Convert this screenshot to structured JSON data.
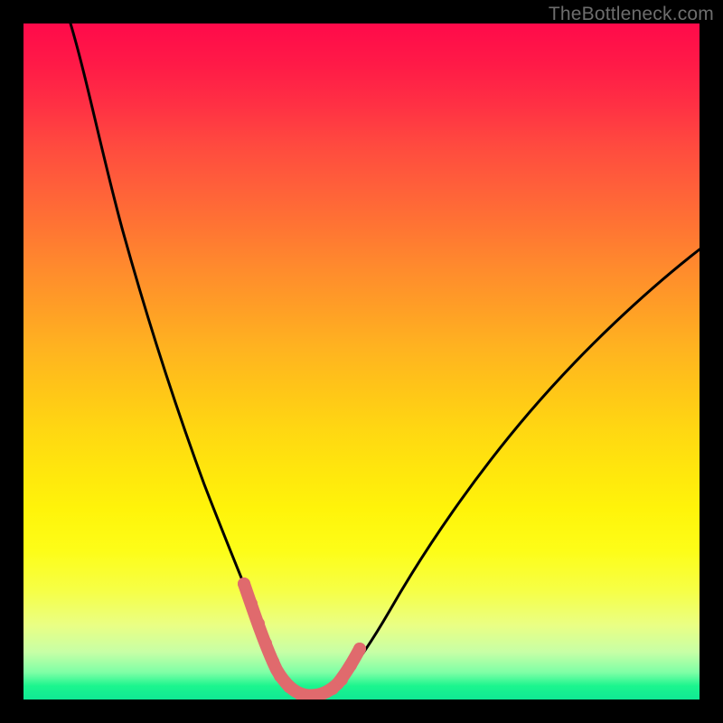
{
  "watermark": {
    "text": "TheBottleneck.com"
  },
  "colors": {
    "background": "#000000",
    "curve": "#000000",
    "highlight": "#e06a6d",
    "gradient_stops": [
      "#ff0a4a",
      "#ff1a47",
      "#ff3044",
      "#ff4a3f",
      "#ff5f3a",
      "#ff7433",
      "#ff8a2d",
      "#ff9e26",
      "#ffb320",
      "#ffc518",
      "#ffd712",
      "#ffe60d",
      "#fff40a",
      "#fdfd18",
      "#f6ff47",
      "#eaff84",
      "#c7ffa6",
      "#7effa6",
      "#1bf58e",
      "#10e894"
    ]
  },
  "chart_data": {
    "type": "line",
    "title": "",
    "xlabel": "",
    "ylabel": "",
    "xlim": [
      0,
      100
    ],
    "ylim": [
      0,
      100
    ],
    "note": "y ≈ bottleneck percentage; curve is a V-shaped bottleneck profile with minimum near x≈40 at y≈0; values estimated from pixel positions",
    "series": [
      {
        "name": "bottleneck-curve",
        "x": [
          7,
          10,
          14,
          18,
          22,
          26,
          29,
          32,
          34,
          36,
          38,
          40,
          42,
          44,
          46,
          50,
          55,
          60,
          66,
          74,
          82,
          90,
          100
        ],
        "y": [
          100,
          87,
          73,
          60,
          48,
          37,
          27,
          19,
          13,
          8,
          4,
          2,
          2,
          3,
          5,
          10,
          17,
          24,
          32,
          42,
          51,
          58,
          67
        ]
      },
      {
        "name": "optimal-range-highlight",
        "x": [
          32,
          33,
          34,
          35,
          36,
          37,
          38,
          39,
          40,
          41,
          42,
          43,
          44,
          45,
          46
        ],
        "y": [
          19,
          16,
          13,
          10,
          8,
          6,
          4,
          3,
          2,
          2,
          2,
          2,
          3,
          4,
          5
        ]
      }
    ]
  }
}
